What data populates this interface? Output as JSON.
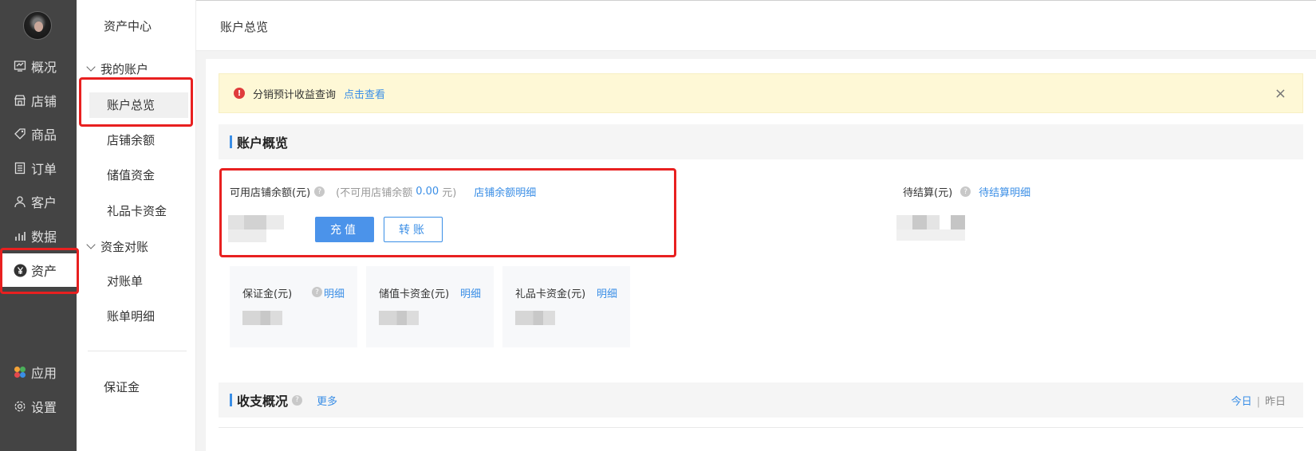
{
  "nav": {
    "items": [
      {
        "label": "概况",
        "icon": "overview-icon"
      },
      {
        "label": "店铺",
        "icon": "shop-icon"
      },
      {
        "label": "商品",
        "icon": "tag-icon"
      },
      {
        "label": "订单",
        "icon": "order-icon"
      },
      {
        "label": "客户",
        "icon": "user-icon"
      },
      {
        "label": "数据",
        "icon": "chart-icon"
      },
      {
        "label": "资产",
        "icon": "yen-icon",
        "active": true
      },
      {
        "label": "应用",
        "icon": "apps-icon"
      },
      {
        "label": "设置",
        "icon": "gear-icon"
      }
    ]
  },
  "submenu": {
    "title": "资产中心",
    "groups": [
      {
        "label": "我的账户",
        "items": [
          "账户总览",
          "店铺余额",
          "储值资金",
          "礼品卡资金"
        ]
      },
      {
        "label": "资金对账",
        "items": [
          "对账单",
          "账单明细"
        ]
      }
    ],
    "extra": "保证金"
  },
  "header": {
    "title": "账户总览"
  },
  "notice": {
    "text": "分销预计收益查询",
    "link": "点击查看",
    "close": "×"
  },
  "overview": {
    "title": "账户概览",
    "available_label": "可用店铺余额(元)",
    "unavailable_prefix": "(不可用店铺余额",
    "unavailable_value": "0.00",
    "unavailable_suffix": "元)",
    "detail_link": "店铺余额明细",
    "recharge_btn": "充值",
    "transfer_btn": "转账",
    "pending_label": "待结算(元)",
    "pending_link": "待结算明细",
    "cards": [
      {
        "label": "保证金(元)",
        "link": "明细"
      },
      {
        "label": "储值卡资金(元)",
        "link": "明细"
      },
      {
        "label": "礼品卡资金(元)",
        "link": "明细"
      }
    ]
  },
  "income": {
    "title": "收支概况",
    "more": "更多",
    "today": "今日",
    "separator": "|",
    "yesterday": "昨日"
  },
  "colors": {
    "accent": "#3a8ee6",
    "nav_bg": "#444444",
    "notice_bg": "#fef8d6",
    "highlight": "#e82020"
  }
}
